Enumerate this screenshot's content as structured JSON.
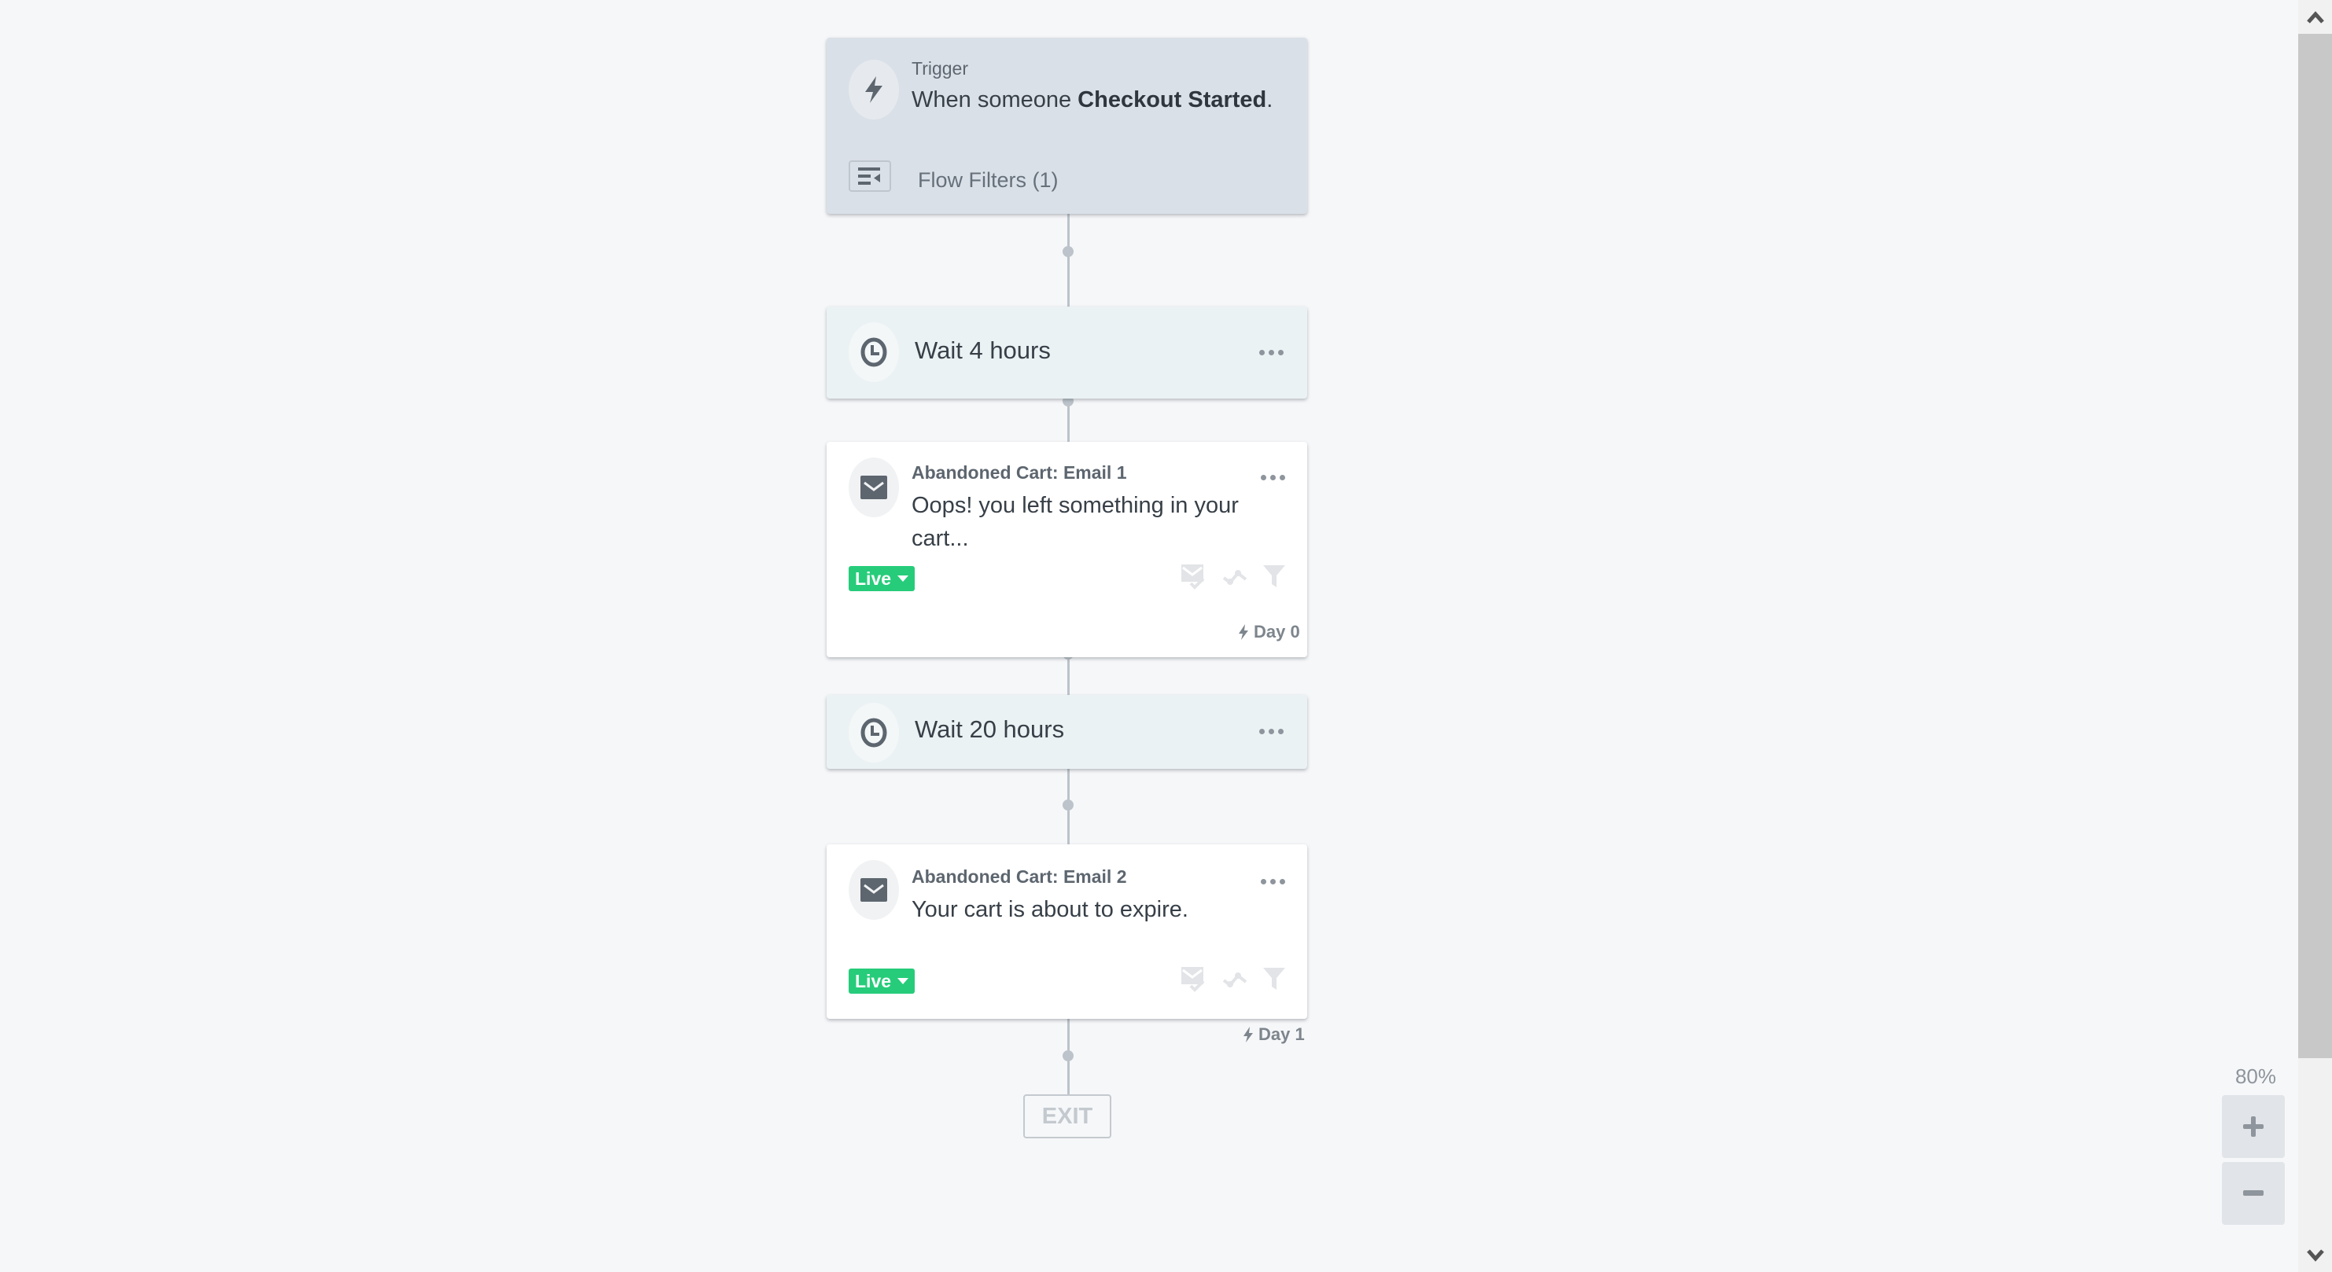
{
  "flow": {
    "trigger": {
      "label": "Trigger",
      "text_prefix": "When someone ",
      "event_name": "Checkout Started",
      "text_suffix": ".",
      "filters_label": "Flow Filters (1)",
      "icon": "lightning-icon"
    },
    "steps": [
      {
        "type": "wait",
        "label": "Wait 4 hours",
        "icon": "clock-icon"
      },
      {
        "type": "email",
        "title": "Abandoned Cart: Email 1",
        "subject": "Oops! you left something in your cart...",
        "status": "Live",
        "day_label": "Day 0",
        "icon": "envelope-icon"
      },
      {
        "type": "wait",
        "label": "Wait 20 hours",
        "icon": "clock-icon"
      },
      {
        "type": "email",
        "title": "Abandoned Cart: Email 2",
        "subject": "Your cart is about to expire.",
        "status": "Live",
        "day_label": "Day 1",
        "icon": "envelope-icon"
      }
    ],
    "exit_label": "EXIT"
  },
  "zoom_controls": {
    "level": "80%",
    "zoom_in_label": "+",
    "zoom_out_label": "−"
  },
  "colors": {
    "live_badge": "#26cc7a",
    "trigger_bg": "#dae0e8",
    "wait_bg": "#ebf2f4",
    "connector": "#bcc3ca"
  }
}
